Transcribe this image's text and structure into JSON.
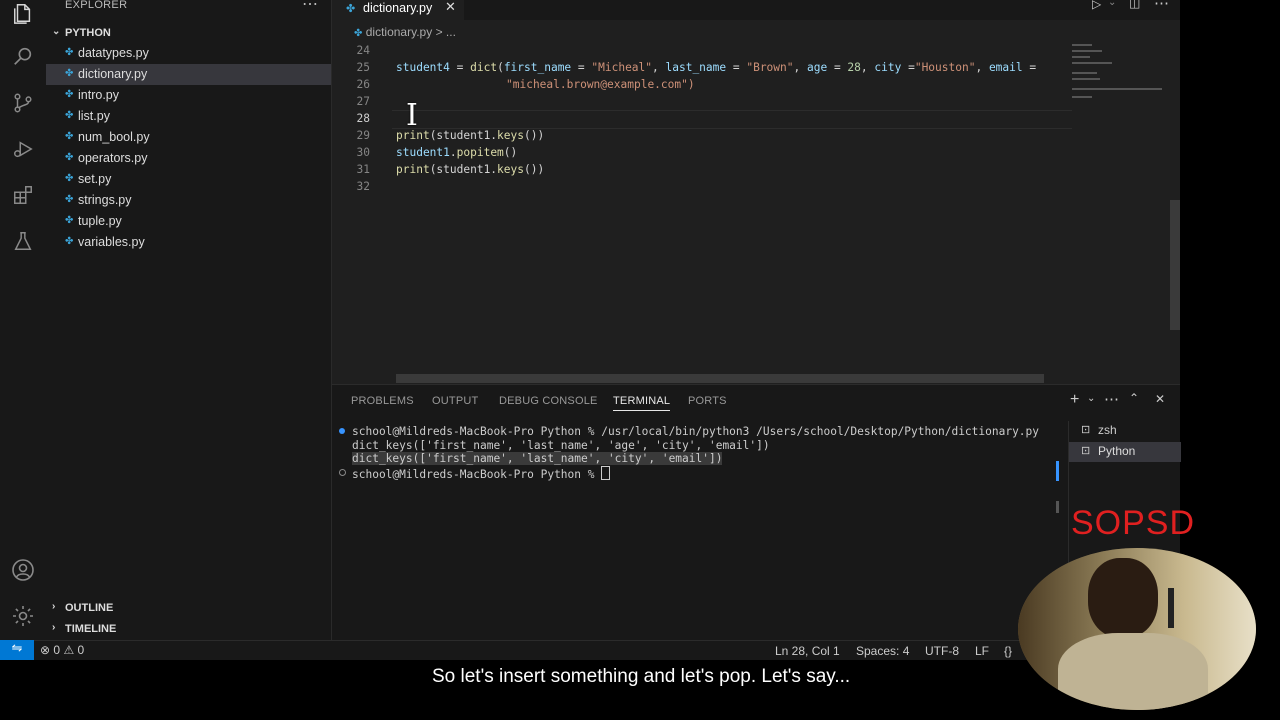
{
  "sidebar": {
    "title": "EXPLORER",
    "folder": "PYTHON",
    "files": [
      {
        "name": "datatypes.py",
        "active": false
      },
      {
        "name": "dictionary.py",
        "active": true
      },
      {
        "name": "intro.py",
        "active": false
      },
      {
        "name": "list.py",
        "active": false
      },
      {
        "name": "num_bool.py",
        "active": false
      },
      {
        "name": "operators.py",
        "active": false
      },
      {
        "name": "set.py",
        "active": false
      },
      {
        "name": "strings.py",
        "active": false
      },
      {
        "name": "tuple.py",
        "active": false
      },
      {
        "name": "variables.py",
        "active": false
      }
    ],
    "outline": "OUTLINE",
    "timeline": "TIMELINE"
  },
  "editor": {
    "tab_label": "dictionary.py",
    "breadcrumb": "dictionary.py",
    "breadcrumb_more": "> ...",
    "line_numbers": [
      "24",
      "25",
      "26",
      "27",
      "28",
      "29",
      "30",
      "31",
      "32"
    ],
    "code": {
      "l25_a": "student4",
      "l25_b": " = ",
      "l25_c": "dict",
      "l25_d": "(",
      "l25_e": "first_name",
      "l25_f": " = ",
      "l25_g": "\"Micheal\"",
      "l25_h": ", ",
      "l25_i": "last_name",
      "l25_j": " = ",
      "l25_k": "\"Brown\"",
      "l25_l": ", ",
      "l25_m": "age",
      "l25_n": " = ",
      "l25_o": "28",
      "l25_p": ", ",
      "l25_q": "city",
      "l25_r": " =",
      "l25_s": "\"Houston\"",
      "l25_t": ", ",
      "l25_u": "email",
      "l25_v": " =",
      "l26": "\"micheal.brown@example.com\")",
      "l29_a": "print",
      "l29_b": "(student1.",
      "l29_c": "keys",
      "l29_d": "())",
      "l30_a": "student1",
      "l30_b": ".",
      "l30_c": "popitem",
      "l30_d": "()",
      "l31_a": "print",
      "l31_b": "(student1.",
      "l31_c": "keys",
      "l31_d": "())"
    }
  },
  "panel": {
    "tabs": [
      "PROBLEMS",
      "OUTPUT",
      "DEBUG CONSOLE",
      "TERMINAL",
      "PORTS"
    ],
    "active_tab": "TERMINAL",
    "terminal_lines": [
      "school@Mildreds-MacBook-Pro Python % /usr/local/bin/python3 /Users/school/Desktop/Python/dictionary.py",
      "dict_keys(['first_name', 'last_name', 'age', 'city', 'email'])",
      "dict_keys(['first_name', 'last_name', 'city', 'email'])",
      "school@Mildreds-MacBook-Pro Python % "
    ],
    "terminals": [
      "zsh",
      "Python"
    ]
  },
  "status": {
    "errors": "0",
    "warnings": "0",
    "position": "Ln 28, Col 1",
    "spaces": "Spaces: 4",
    "encoding": "UTF-8",
    "eol": "LF"
  },
  "overlay": {
    "subtitle": "So let's insert something and let's pop. Let's say...",
    "brand": "SOPSD"
  },
  "colors": {
    "accent": "#0078d4",
    "brand": "#e02020"
  }
}
